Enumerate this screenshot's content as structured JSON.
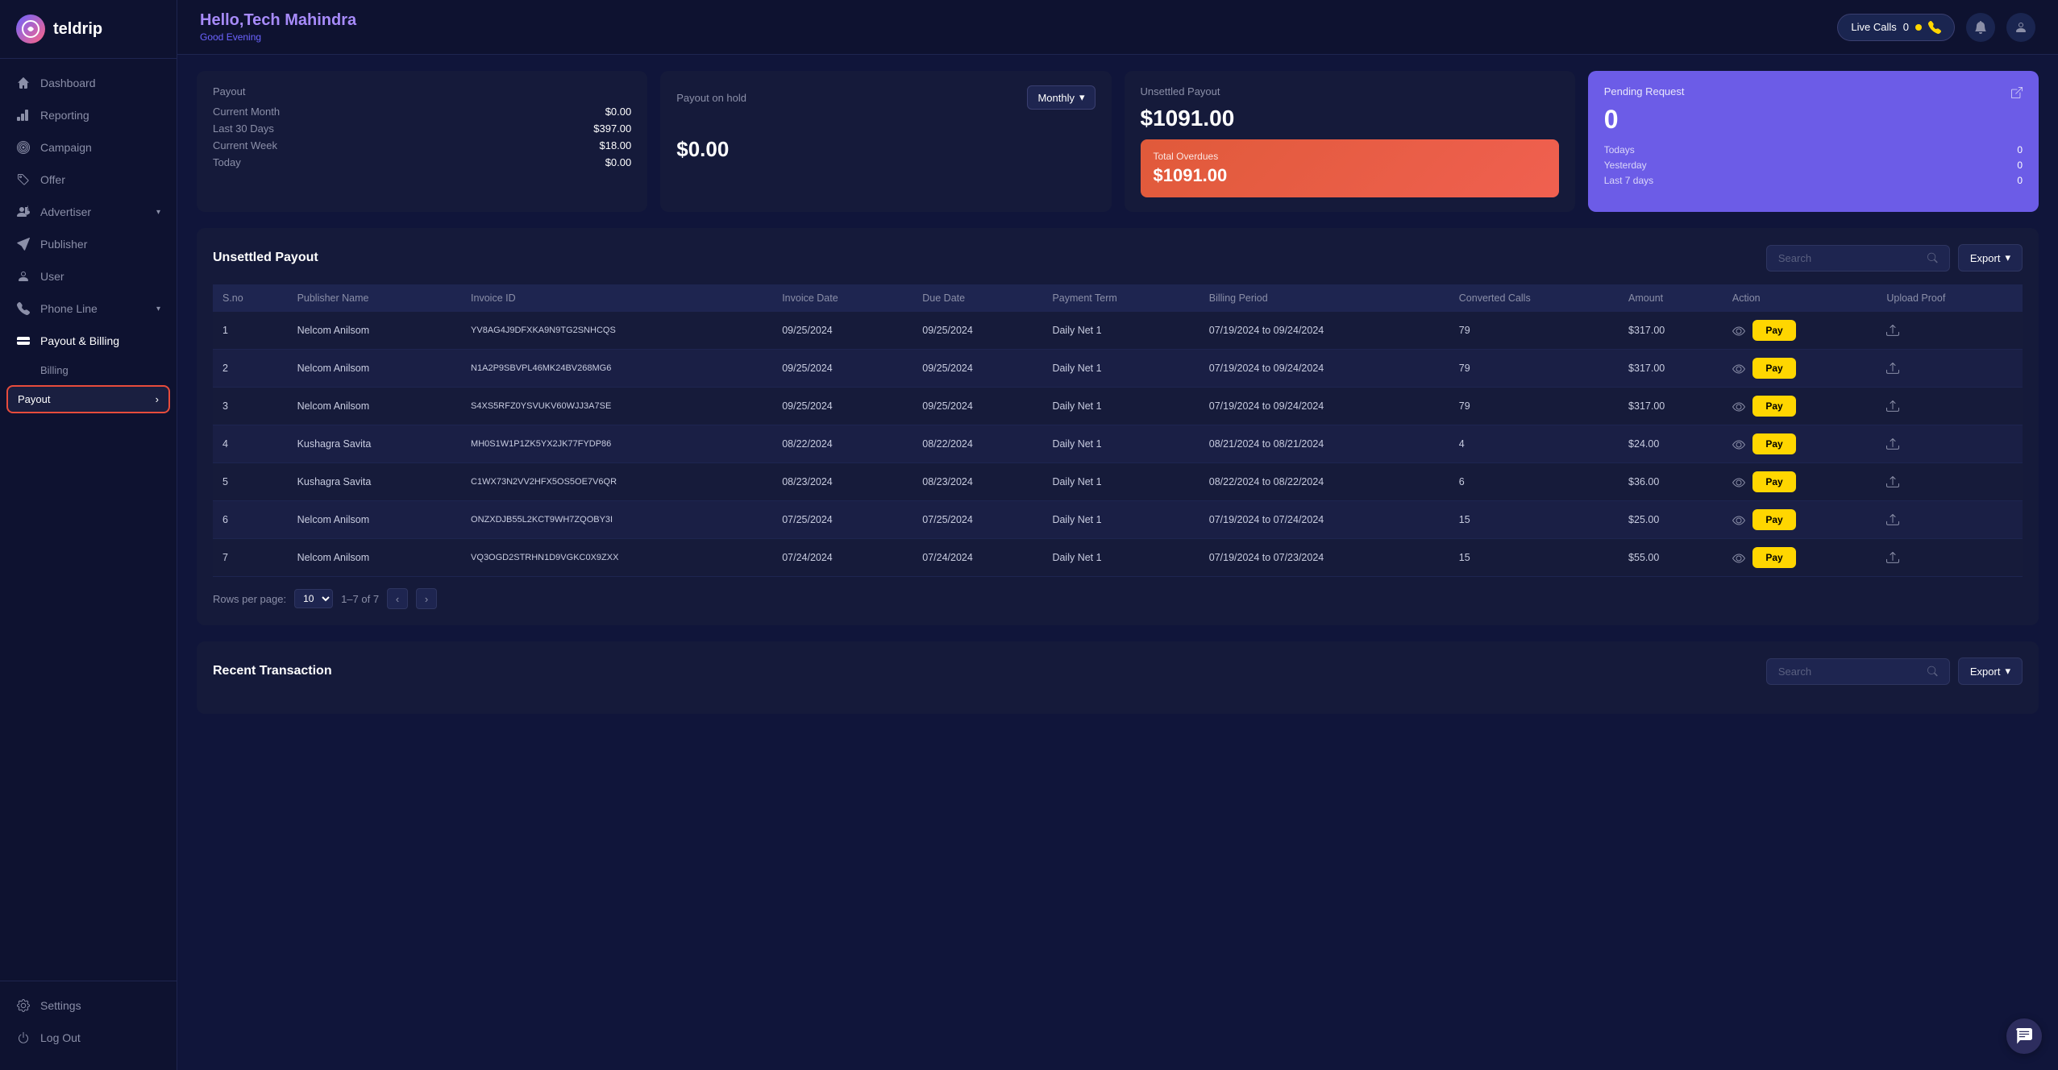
{
  "app": {
    "name": "teldrip",
    "logo_initials": "td"
  },
  "header": {
    "greeting": "Hello,",
    "user": "Tech Mahindra",
    "sub_greeting": "Good Evening",
    "live_calls_label": "Live Calls",
    "live_calls_count": "0"
  },
  "sidebar": {
    "items": [
      {
        "id": "dashboard",
        "label": "Dashboard",
        "icon": "home"
      },
      {
        "id": "reporting",
        "label": "Reporting",
        "icon": "bar-chart"
      },
      {
        "id": "campaign",
        "label": "Campaign",
        "icon": "target"
      },
      {
        "id": "offer",
        "label": "Offer",
        "icon": "tag"
      },
      {
        "id": "advertiser",
        "label": "Advertiser",
        "icon": "user-tie",
        "has_chevron": true
      },
      {
        "id": "publisher",
        "label": "Publisher",
        "icon": "send"
      },
      {
        "id": "user",
        "label": "User",
        "icon": "user"
      },
      {
        "id": "phone-line",
        "label": "Phone Line",
        "icon": "phone",
        "has_chevron": true
      },
      {
        "id": "payout-billing",
        "label": "Payout & Billing",
        "icon": "credit-card"
      },
      {
        "id": "billing",
        "label": "Billing",
        "icon": ""
      },
      {
        "id": "payout",
        "label": "Payout",
        "icon": ""
      }
    ],
    "bottom_items": [
      {
        "id": "settings",
        "label": "Settings",
        "icon": "settings"
      },
      {
        "id": "logout",
        "label": "Log Out",
        "icon": "power"
      }
    ]
  },
  "payout_card": {
    "title": "Payout",
    "rows": [
      {
        "label": "Current Month",
        "value": "$0.00"
      },
      {
        "label": "Last 30 Days",
        "value": "$397.00"
      },
      {
        "label": "Current Week",
        "value": "$18.00"
      },
      {
        "label": "Today",
        "value": "$0.00"
      }
    ]
  },
  "payout_on_hold_card": {
    "title": "Payout on hold",
    "dropdown_label": "Monthly",
    "amount": "$0.00"
  },
  "unsettled_payout_card": {
    "title": "Unsettled Payout",
    "amount": "$1091.00",
    "overdues_label": "Total Overdues",
    "overdues_amount": "$1091.00"
  },
  "pending_request_card": {
    "title": "Pending Request",
    "count": "0",
    "rows": [
      {
        "label": "Todays",
        "value": "0"
      },
      {
        "label": "Yesterday",
        "value": "0"
      },
      {
        "label": "Last 7 days",
        "value": "0"
      }
    ]
  },
  "unsettled_table": {
    "section_title": "Unsettled Payout",
    "search_placeholder": "Search",
    "export_label": "Export",
    "columns": [
      "S.no",
      "Publisher Name",
      "Invoice ID",
      "Invoice Date",
      "Due Date",
      "Payment Term",
      "Billing Period",
      "Converted Calls",
      "Amount",
      "Action",
      "Upload Proof"
    ],
    "rows": [
      {
        "sno": "1",
        "publisher": "Nelcom Anilsom",
        "invoice_id": "YV8AG4J9DFXKA9N9TG2SNHCQS",
        "invoice_date": "09/25/2024",
        "due_date": "09/25/2024",
        "payment_term": "Daily Net 1",
        "billing_period": "07/19/2024 to 09/24/2024",
        "converted_calls": "79",
        "amount": "$317.00"
      },
      {
        "sno": "2",
        "publisher": "Nelcom Anilsom",
        "invoice_id": "N1A2P9SBVPL46MK24BV268MG6",
        "invoice_date": "09/25/2024",
        "due_date": "09/25/2024",
        "payment_term": "Daily Net 1",
        "billing_period": "07/19/2024 to 09/24/2024",
        "converted_calls": "79",
        "amount": "$317.00"
      },
      {
        "sno": "3",
        "publisher": "Nelcom Anilsom",
        "invoice_id": "S4XS5RFZ0YSVUKV60WJJ3A7SE",
        "invoice_date": "09/25/2024",
        "due_date": "09/25/2024",
        "payment_term": "Daily Net 1",
        "billing_period": "07/19/2024 to 09/24/2024",
        "converted_calls": "79",
        "amount": "$317.00"
      },
      {
        "sno": "4",
        "publisher": "Kushagra Savita",
        "invoice_id": "MH0S1W1P1ZK5YX2JK77FYDP86",
        "invoice_date": "08/22/2024",
        "due_date": "08/22/2024",
        "payment_term": "Daily Net 1",
        "billing_period": "08/21/2024 to 08/21/2024",
        "converted_calls": "4",
        "amount": "$24.00"
      },
      {
        "sno": "5",
        "publisher": "Kushagra Savita",
        "invoice_id": "C1WX73N2VV2HFX5OS5OE7V6QR",
        "invoice_date": "08/23/2024",
        "due_date": "08/23/2024",
        "payment_term": "Daily Net 1",
        "billing_period": "08/22/2024 to 08/22/2024",
        "converted_calls": "6",
        "amount": "$36.00"
      },
      {
        "sno": "6",
        "publisher": "Nelcom Anilsom",
        "invoice_id": "ONZXDJB55L2KCT9WH7ZQOBY3I",
        "invoice_date": "07/25/2024",
        "due_date": "07/25/2024",
        "payment_term": "Daily Net 1",
        "billing_period": "07/19/2024 to 07/24/2024",
        "converted_calls": "15",
        "amount": "$25.00"
      },
      {
        "sno": "7",
        "publisher": "Nelcom Anilsom",
        "invoice_id": "VQ3OGD2STRHN1D9VGKC0X9ZXX",
        "invoice_date": "07/24/2024",
        "due_date": "07/24/2024",
        "payment_term": "Daily Net 1",
        "billing_period": "07/19/2024 to 07/23/2024",
        "converted_calls": "15",
        "amount": "$55.00"
      }
    ],
    "pagination": {
      "rows_per_page_label": "Rows per page:",
      "rows_per_page_value": "10",
      "range": "1–7 of 7"
    },
    "pay_button_label": "Pay"
  },
  "recent_transaction": {
    "section_title": "Recent Transaction",
    "search_placeholder": "Search",
    "export_label": "Export"
  }
}
